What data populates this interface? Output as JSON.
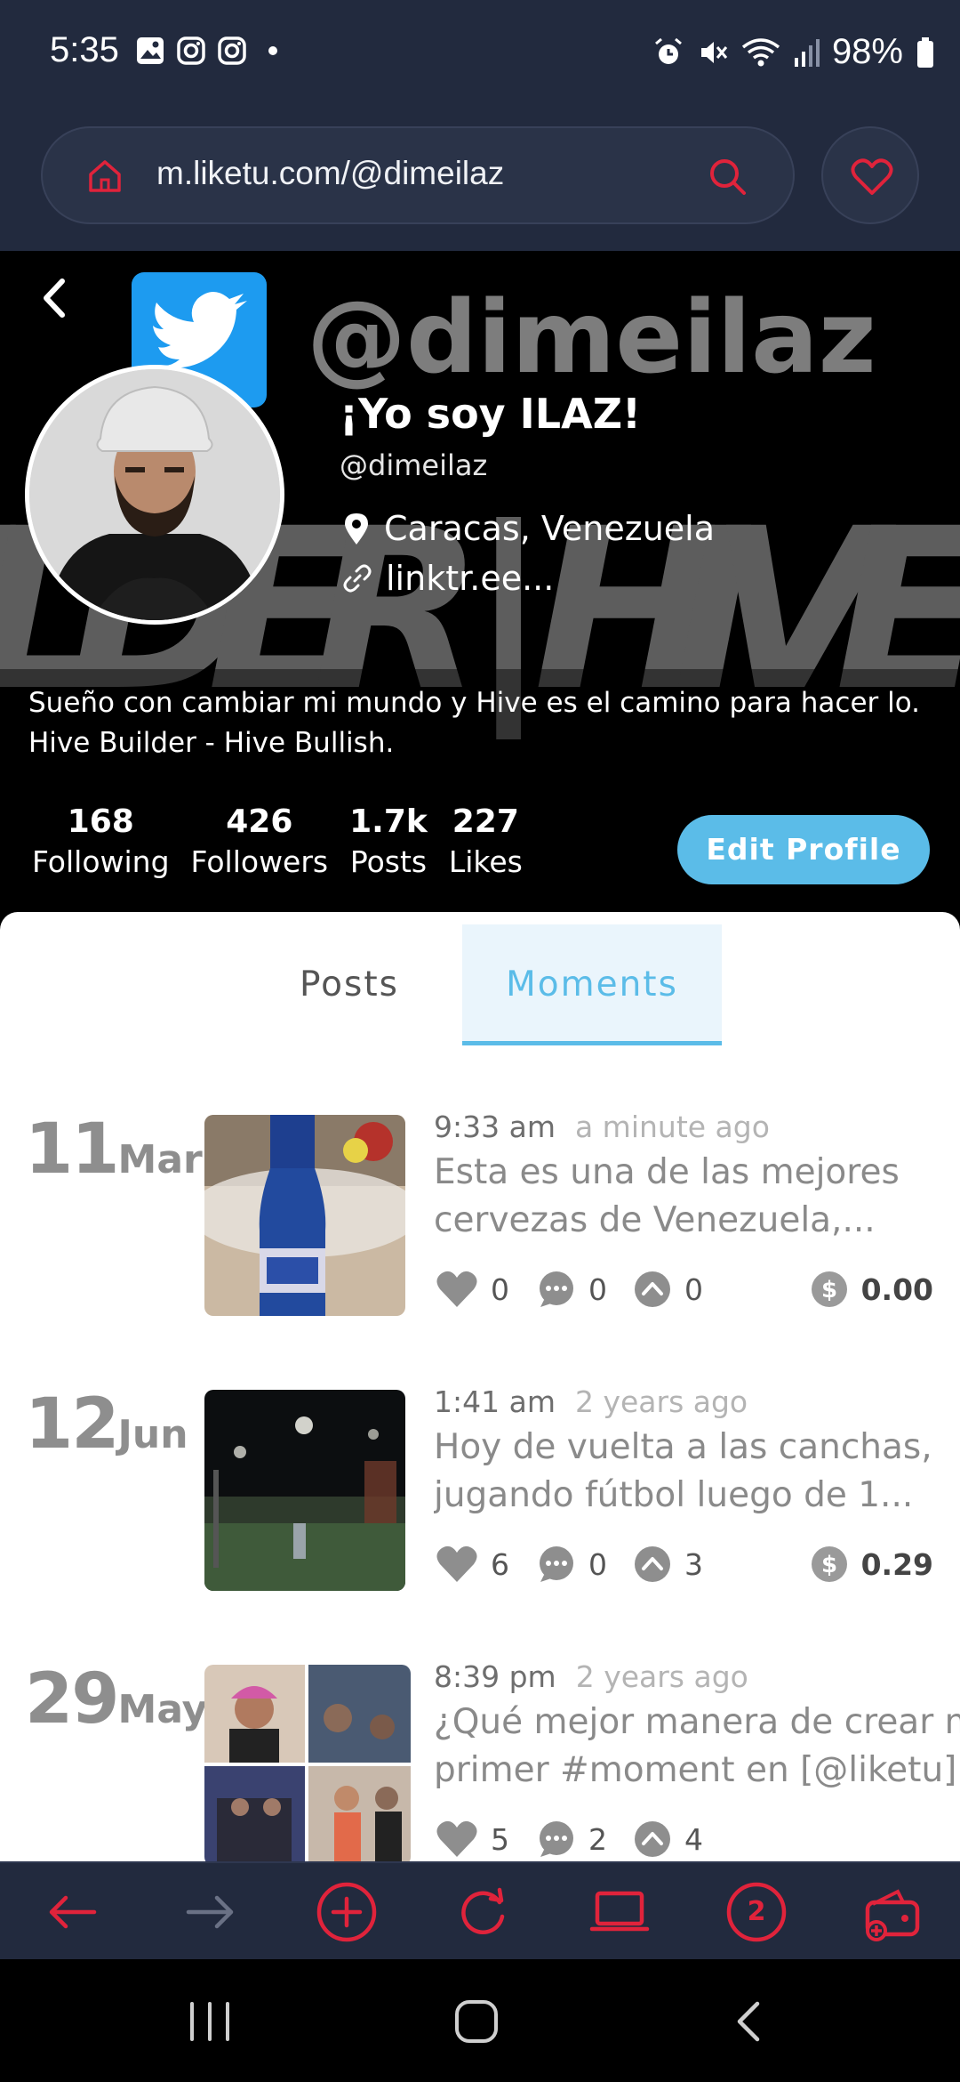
{
  "status_bar": {
    "time": "5:35",
    "battery": "98%",
    "left_icons": [
      "gallery-icon",
      "instagram-icon",
      "instagram-icon",
      "dot-icon"
    ],
    "right_icons": [
      "alarm-icon",
      "mute-icon",
      "wifi-icon",
      "signal-icon",
      "battery-icon"
    ]
  },
  "browser": {
    "url": "m.liketu.com/@dimeilaz",
    "accent_color": "#e0233b"
  },
  "profile": {
    "banner_text": "@dimeilaz",
    "banner_subtext": "ILDER | HIVE",
    "display_name": "¡Yo soy ILAZ!",
    "handle": "@dimeilaz",
    "location": "Caracas, Venezuela",
    "link": "linktr.ee...",
    "bio": "Sueño con cambiar mi mundo y Hive es el camino para hacer lo. Hive Builder - Hive Bullish.",
    "stats": [
      {
        "value": "168",
        "label": "Following"
      },
      {
        "value": "426",
        "label": "Followers"
      },
      {
        "value": "1.7k",
        "label": "Posts"
      },
      {
        "value": "227",
        "label": "Likes"
      }
    ],
    "edit_button": "Edit Profile"
  },
  "tabs": {
    "posts": "Posts",
    "moments": "Moments",
    "active": "Moments"
  },
  "moments": [
    {
      "day": "11",
      "month": "Mar",
      "time": "9:33 am",
      "ago": "a minute ago",
      "title_line1": "Esta es una de las mejores",
      "title_line2": "cervezas de Venezuela,...",
      "likes": "0",
      "comments": "0",
      "reblogs": "0",
      "payout": "0.00"
    },
    {
      "day": "12",
      "month": "Jun",
      "time": "1:41 am",
      "ago": "2 years ago",
      "title_line1": "Hoy de vuelta a las canchas,",
      "title_line2": "jugando fútbol luego de 1...",
      "likes": "6",
      "comments": "0",
      "reblogs": "3",
      "payout": "0.29"
    },
    {
      "day": "29",
      "month": "May",
      "time": "8:39 pm",
      "ago": "2 years ago",
      "title_line1": "¿Qué mejor manera de crear mi",
      "title_line2": "primer #moment en [@liketu]...",
      "likes": "5",
      "comments": "2",
      "reblogs": "4",
      "payout": ""
    }
  ],
  "toolbar": {
    "tab_count": "2",
    "icons": [
      "back-arrow-icon",
      "forward-arrow-icon",
      "add-tab-icon",
      "reload-icon",
      "desktop-icon",
      "tabs-count-icon",
      "wallet-icon"
    ]
  },
  "system_nav": [
    "recent-apps-icon",
    "home-icon",
    "back-icon"
  ]
}
